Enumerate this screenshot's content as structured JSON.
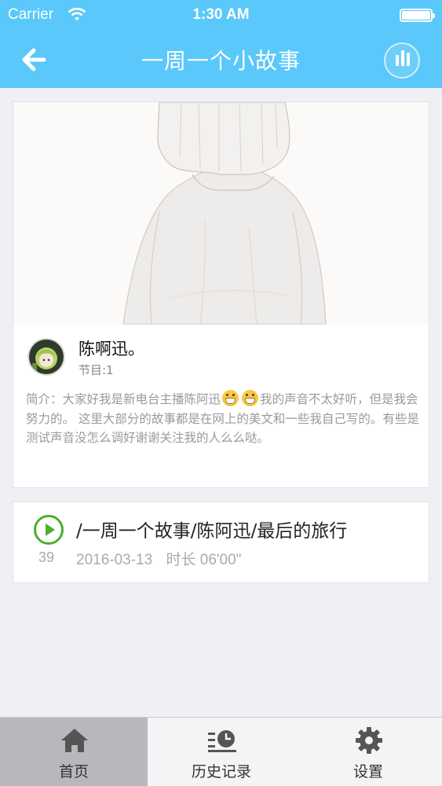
{
  "status_bar": {
    "carrier": "Carrier",
    "time": "1:30 AM",
    "wifi_icon": "wifi-icon",
    "battery_icon": "battery-icon"
  },
  "nav": {
    "title": "一周一个小故事",
    "back_icon": "back-arrow-icon",
    "player_icon": "equalizer-icon",
    "bar_color": "#5ac8fa"
  },
  "program_card": {
    "host_name": "陈啊迅。",
    "program_label": "节目:1",
    "intro_part1": "简介：大家好我是新电台主播陈阿迅",
    "intro_part2": "我的声音不太好听，但是我会努力的。 这里大部分的故事都是在网上的美文和一些我自己写的。有些是测试声音没怎么调好谢谢关注我的人么么哒。",
    "emoji_icon": "grinning-face-icon"
  },
  "episode": {
    "title": "/一周一个故事/陈阿迅/最后的旅行",
    "play_count": "39",
    "date": "2016-03-13",
    "duration": "时长 06'00\"",
    "play_icon": "play-circle-icon",
    "accent_color": "#4cae2f"
  },
  "tab_bar": {
    "tabs": [
      {
        "label": "首页",
        "icon": "home-icon",
        "active": true
      },
      {
        "label": "历史记录",
        "icon": "history-icon",
        "active": false
      },
      {
        "label": "设置",
        "icon": "gear-icon",
        "active": false
      }
    ]
  }
}
